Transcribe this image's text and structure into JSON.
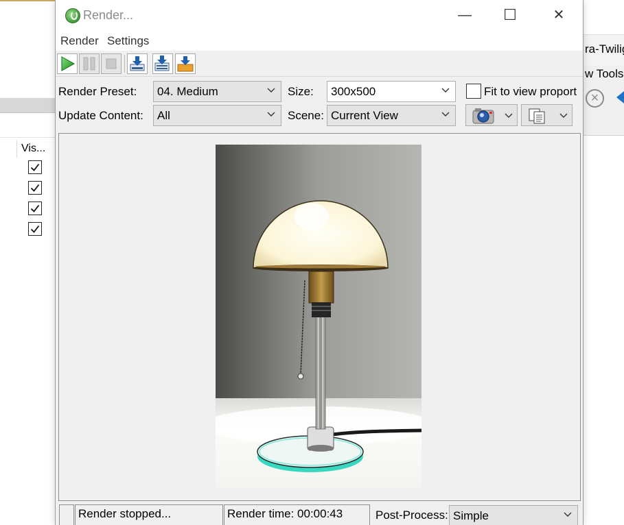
{
  "background": {
    "left_panel": {
      "column_header": "Vis...",
      "checkbox_count": 4
    },
    "right_panel": {
      "title_fragment": "ra-Twilig",
      "menu_fragment": "w  Tools"
    }
  },
  "dialog": {
    "title": "Render...",
    "window_controls": {
      "minimize": "—",
      "maximize": "☐",
      "close": "✕"
    },
    "menu": {
      "render": "Render",
      "settings": "Settings"
    },
    "toolbar": {
      "buttons": [
        "play-icon",
        "pause-icon",
        "stop-icon",
        "save-icon",
        "save-all-icon",
        "export-icon"
      ]
    },
    "settings": {
      "render_preset_label": "Render Preset:",
      "render_preset_value": "04. Medium",
      "size_label": "Size:",
      "size_value": "300x500",
      "fit_to_view_label": "Fit to view proport",
      "fit_to_view_checked": false,
      "update_content_label": "Update Content:",
      "update_content_value": "All",
      "scene_label": "Scene:",
      "scene_value": "Current View"
    },
    "status": {
      "message": "Render stopped...",
      "render_time": "Render time: 00:00:43",
      "post_process_label": "Post-Process:",
      "post_process_value": "Simple"
    }
  },
  "colors": {
    "dialog_bg": "#f0f0f0",
    "play_green": "#2fa32f",
    "download_blue": "#1e5fb0",
    "export_orange": "#e8a12c",
    "lamp_base_glow": "#38d8c0"
  }
}
